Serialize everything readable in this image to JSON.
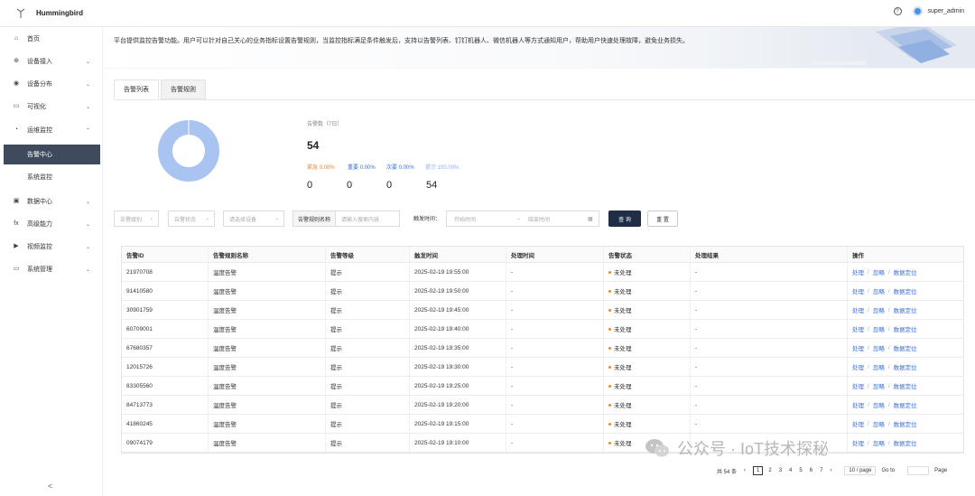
{
  "app": {
    "title": "Hummingbird",
    "user": "super_admin"
  },
  "sidebar": {
    "items": [
      {
        "label": "首页",
        "icon": "home-icon",
        "glyph": "⌂"
      },
      {
        "label": "设备接入",
        "icon": "globe-icon",
        "glyph": "⊕"
      },
      {
        "label": "设备分布",
        "icon": "location-icon",
        "glyph": "◉"
      },
      {
        "label": "可视化",
        "icon": "monitor-icon",
        "glyph": "▭"
      },
      {
        "label": "运维监控",
        "icon": "clock-icon",
        "glyph": "◔"
      },
      {
        "label": "告警中心",
        "icon": "",
        "glyph": ""
      },
      {
        "label": "系统监控",
        "icon": "",
        "glyph": ""
      },
      {
        "label": "数据中心",
        "icon": "database-icon",
        "glyph": "▣"
      },
      {
        "label": "高级能力",
        "icon": "function-icon",
        "glyph": "fx"
      },
      {
        "label": "视频监控",
        "icon": "video-icon",
        "glyph": "▶"
      },
      {
        "label": "系统管理",
        "icon": "settings-monitor-icon",
        "glyph": "▭"
      }
    ],
    "collapse": "<"
  },
  "banner": {
    "description": "平台提供监控告警功能。用户可以针对自己关心的业务指标设置告警规则，当监控指标满足条件触发后，支持以告警列表、钉钉机器人、微信机器人等方式通知用户，帮助用户快速处理故障，避免业务损失。"
  },
  "tabs": [
    {
      "label": "告警列表"
    },
    {
      "label": "告警规则"
    }
  ],
  "stats": {
    "title": "告警数（7日）",
    "total": "54",
    "levels": [
      {
        "label": "紧急",
        "pct": "0.00%",
        "count": "0",
        "color": "#e8823a"
      },
      {
        "label": "重要",
        "pct": "0.00%",
        "count": "0",
        "color": "#3a6fd8"
      },
      {
        "label": "次要",
        "pct": "0.00%",
        "count": "0",
        "color": "#3a6fd8"
      },
      {
        "label": "提示",
        "pct": "100.00%",
        "count": "54",
        "color": "#8fb0e8"
      }
    ],
    "donut_color": "#a9c4f0",
    "donut_fraction": 1.0
  },
  "filters": {
    "level_placeholder": "告警级别",
    "status_placeholder": "告警状态",
    "device_placeholder": "请选择设备",
    "rule_label": "告警规则名称",
    "rule_placeholder": "请输入搜索内容",
    "time_label": "触发时间：",
    "start_placeholder": "开始时间",
    "range_arrow": "→",
    "end_placeholder": "结束时间",
    "query": "查 询",
    "reset": "重 置"
  },
  "table": {
    "columns": [
      "告警ID",
      "告警规则名称",
      "告警等级",
      "触发时间",
      "处理时间",
      "告警状态",
      "处理结果",
      "操作"
    ],
    "rows": [
      {
        "id": "21970708",
        "rule": "温度告警",
        "level": "提示",
        "time": "2025-02-19 19:55:00",
        "handled": "-",
        "status": "未处理",
        "result": "-"
      },
      {
        "id": "91410580",
        "rule": "温度告警",
        "level": "提示",
        "time": "2025-02-19 19:50:00",
        "handled": "-",
        "status": "未处理",
        "result": "-"
      },
      {
        "id": "30901759",
        "rule": "温度告警",
        "level": "提示",
        "time": "2025-02-19 19:45:00",
        "handled": "-",
        "status": "未处理",
        "result": "-"
      },
      {
        "id": "60709001",
        "rule": "温度告警",
        "level": "提示",
        "time": "2025-02-19 19:40:00",
        "handled": "-",
        "status": "未处理",
        "result": "-"
      },
      {
        "id": "67680357",
        "rule": "温度告警",
        "level": "提示",
        "time": "2025-02-19 19:35:00",
        "handled": "-",
        "status": "未处理",
        "result": "-"
      },
      {
        "id": "12015726",
        "rule": "温度告警",
        "level": "提示",
        "time": "2025-02-19 19:30:00",
        "handled": "-",
        "status": "未处理",
        "result": "-"
      },
      {
        "id": "83305560",
        "rule": "温度告警",
        "level": "提示",
        "time": "2025-02-19 19:25:00",
        "handled": "-",
        "status": "未处理",
        "result": "-"
      },
      {
        "id": "84713773",
        "rule": "温度告警",
        "level": "提示",
        "time": "2025-02-19 19:20:00",
        "handled": "-",
        "status": "未处理",
        "result": "-"
      },
      {
        "id": "41860245",
        "rule": "温度告警",
        "level": "提示",
        "time": "2025-02-19 19:15:00",
        "handled": "-",
        "status": "未处理",
        "result": "-"
      },
      {
        "id": "09074179",
        "rule": "温度告警",
        "level": "提示",
        "time": "2025-02-19 19:10:00",
        "handled": "-",
        "status": "未处理",
        "result": "-"
      }
    ],
    "actions": [
      "处理",
      "忽略",
      "数据定位"
    ],
    "action_sep": "/"
  },
  "pager": {
    "total": "共 54 条",
    "pages": [
      "1",
      "2",
      "3",
      "4",
      "5",
      "6",
      "7"
    ],
    "size": "10 / page",
    "goto": "Go to",
    "page": "Page"
  },
  "watermark": "公众号 · IoT技术探秘"
}
